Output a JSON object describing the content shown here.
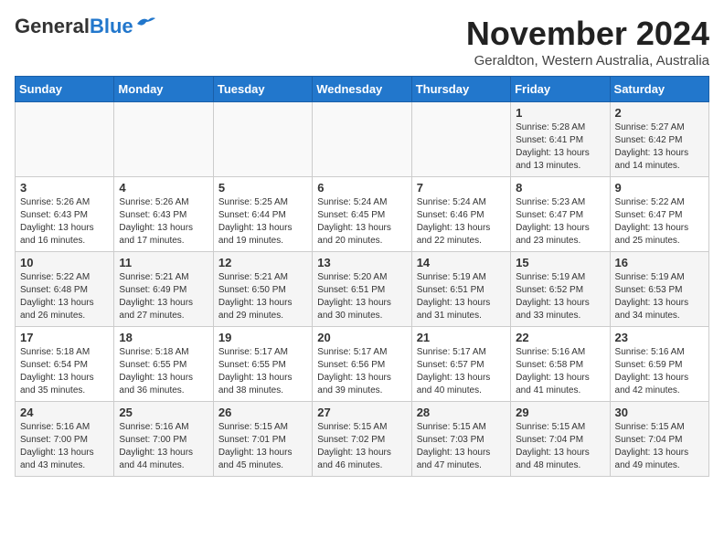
{
  "header": {
    "logo_line1": "General",
    "logo_line2": "Blue",
    "month_title": "November 2024",
    "location": "Geraldton, Western Australia, Australia"
  },
  "weekdays": [
    "Sunday",
    "Monday",
    "Tuesday",
    "Wednesday",
    "Thursday",
    "Friday",
    "Saturday"
  ],
  "weeks": [
    [
      {
        "day": "",
        "info": ""
      },
      {
        "day": "",
        "info": ""
      },
      {
        "day": "",
        "info": ""
      },
      {
        "day": "",
        "info": ""
      },
      {
        "day": "",
        "info": ""
      },
      {
        "day": "1",
        "info": "Sunrise: 5:28 AM\nSunset: 6:41 PM\nDaylight: 13 hours\nand 13 minutes."
      },
      {
        "day": "2",
        "info": "Sunrise: 5:27 AM\nSunset: 6:42 PM\nDaylight: 13 hours\nand 14 minutes."
      }
    ],
    [
      {
        "day": "3",
        "info": "Sunrise: 5:26 AM\nSunset: 6:43 PM\nDaylight: 13 hours\nand 16 minutes."
      },
      {
        "day": "4",
        "info": "Sunrise: 5:26 AM\nSunset: 6:43 PM\nDaylight: 13 hours\nand 17 minutes."
      },
      {
        "day": "5",
        "info": "Sunrise: 5:25 AM\nSunset: 6:44 PM\nDaylight: 13 hours\nand 19 minutes."
      },
      {
        "day": "6",
        "info": "Sunrise: 5:24 AM\nSunset: 6:45 PM\nDaylight: 13 hours\nand 20 minutes."
      },
      {
        "day": "7",
        "info": "Sunrise: 5:24 AM\nSunset: 6:46 PM\nDaylight: 13 hours\nand 22 minutes."
      },
      {
        "day": "8",
        "info": "Sunrise: 5:23 AM\nSunset: 6:47 PM\nDaylight: 13 hours\nand 23 minutes."
      },
      {
        "day": "9",
        "info": "Sunrise: 5:22 AM\nSunset: 6:47 PM\nDaylight: 13 hours\nand 25 minutes."
      }
    ],
    [
      {
        "day": "10",
        "info": "Sunrise: 5:22 AM\nSunset: 6:48 PM\nDaylight: 13 hours\nand 26 minutes."
      },
      {
        "day": "11",
        "info": "Sunrise: 5:21 AM\nSunset: 6:49 PM\nDaylight: 13 hours\nand 27 minutes."
      },
      {
        "day": "12",
        "info": "Sunrise: 5:21 AM\nSunset: 6:50 PM\nDaylight: 13 hours\nand 29 minutes."
      },
      {
        "day": "13",
        "info": "Sunrise: 5:20 AM\nSunset: 6:51 PM\nDaylight: 13 hours\nand 30 minutes."
      },
      {
        "day": "14",
        "info": "Sunrise: 5:19 AM\nSunset: 6:51 PM\nDaylight: 13 hours\nand 31 minutes."
      },
      {
        "day": "15",
        "info": "Sunrise: 5:19 AM\nSunset: 6:52 PM\nDaylight: 13 hours\nand 33 minutes."
      },
      {
        "day": "16",
        "info": "Sunrise: 5:19 AM\nSunset: 6:53 PM\nDaylight: 13 hours\nand 34 minutes."
      }
    ],
    [
      {
        "day": "17",
        "info": "Sunrise: 5:18 AM\nSunset: 6:54 PM\nDaylight: 13 hours\nand 35 minutes."
      },
      {
        "day": "18",
        "info": "Sunrise: 5:18 AM\nSunset: 6:55 PM\nDaylight: 13 hours\nand 36 minutes."
      },
      {
        "day": "19",
        "info": "Sunrise: 5:17 AM\nSunset: 6:55 PM\nDaylight: 13 hours\nand 38 minutes."
      },
      {
        "day": "20",
        "info": "Sunrise: 5:17 AM\nSunset: 6:56 PM\nDaylight: 13 hours\nand 39 minutes."
      },
      {
        "day": "21",
        "info": "Sunrise: 5:17 AM\nSunset: 6:57 PM\nDaylight: 13 hours\nand 40 minutes."
      },
      {
        "day": "22",
        "info": "Sunrise: 5:16 AM\nSunset: 6:58 PM\nDaylight: 13 hours\nand 41 minutes."
      },
      {
        "day": "23",
        "info": "Sunrise: 5:16 AM\nSunset: 6:59 PM\nDaylight: 13 hours\nand 42 minutes."
      }
    ],
    [
      {
        "day": "24",
        "info": "Sunrise: 5:16 AM\nSunset: 7:00 PM\nDaylight: 13 hours\nand 43 minutes."
      },
      {
        "day": "25",
        "info": "Sunrise: 5:16 AM\nSunset: 7:00 PM\nDaylight: 13 hours\nand 44 minutes."
      },
      {
        "day": "26",
        "info": "Sunrise: 5:15 AM\nSunset: 7:01 PM\nDaylight: 13 hours\nand 45 minutes."
      },
      {
        "day": "27",
        "info": "Sunrise: 5:15 AM\nSunset: 7:02 PM\nDaylight: 13 hours\nand 46 minutes."
      },
      {
        "day": "28",
        "info": "Sunrise: 5:15 AM\nSunset: 7:03 PM\nDaylight: 13 hours\nand 47 minutes."
      },
      {
        "day": "29",
        "info": "Sunrise: 5:15 AM\nSunset: 7:04 PM\nDaylight: 13 hours\nand 48 minutes."
      },
      {
        "day": "30",
        "info": "Sunrise: 5:15 AM\nSunset: 7:04 PM\nDaylight: 13 hours\nand 49 minutes."
      }
    ]
  ]
}
